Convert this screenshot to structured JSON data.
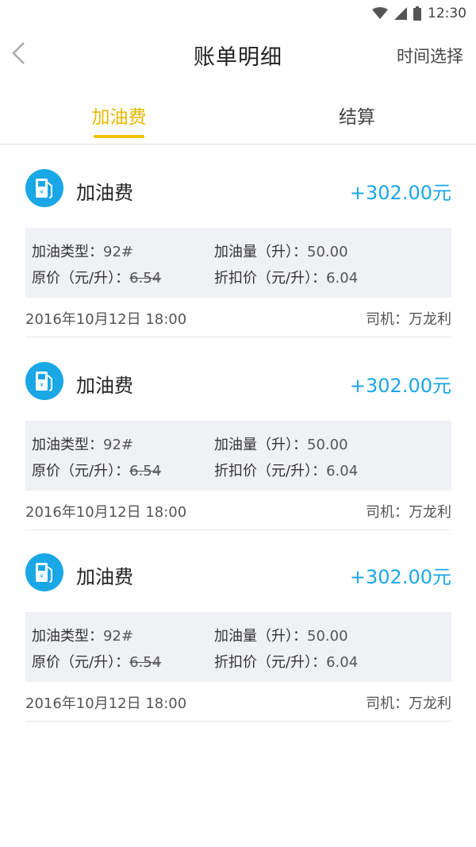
{
  "status_bar": {
    "time": "12:30"
  },
  "header": {
    "title": "账单明细",
    "action_label": "时间选择"
  },
  "tabs": [
    {
      "label": "加油费",
      "active": true
    },
    {
      "label": "结算",
      "active": false
    }
  ],
  "colors": {
    "accent_yellow": "#f2c200",
    "amount_blue": "#1aa7e6",
    "detail_bg": "#f0f1f5"
  },
  "records": [
    {
      "title": "加油费",
      "amount": "+302.00元",
      "fuel_type_label": "加油类型：",
      "fuel_type_value": "92#",
      "volume_label": "加油量（升）：",
      "volume_value": "50.00",
      "original_price_label": "原价（元/升）：",
      "original_price_value": "6.54",
      "discount_price_label": "折扣价（元/升）：",
      "discount_price_value": "6.04",
      "datetime": "2016年10月12日 18:00",
      "driver": "司机：万龙利",
      "icon": "fuel-pump-icon"
    },
    {
      "title": "加油费",
      "amount": "+302.00元",
      "fuel_type_label": "加油类型：",
      "fuel_type_value": "92#",
      "volume_label": "加油量（升）：",
      "volume_value": "50.00",
      "original_price_label": "原价（元/升）：",
      "original_price_value": "6.54",
      "discount_price_label": "折扣价（元/升）：",
      "discount_price_value": "6.04",
      "datetime": "2016年10月12日 18:00",
      "driver": "司机：万龙利",
      "icon": "fuel-pump-icon"
    },
    {
      "title": "加油费",
      "amount": "+302.00元",
      "fuel_type_label": "加油类型：",
      "fuel_type_value": "92#",
      "volume_label": "加油量（升）：",
      "volume_value": "50.00",
      "original_price_label": "原价（元/升）：",
      "original_price_value": "6.54",
      "discount_price_label": "折扣价（元/升）：",
      "discount_price_value": "6.04",
      "datetime": "2016年10月12日 18:00",
      "driver": "司机：万龙利",
      "icon": "fuel-pump-icon"
    }
  ]
}
